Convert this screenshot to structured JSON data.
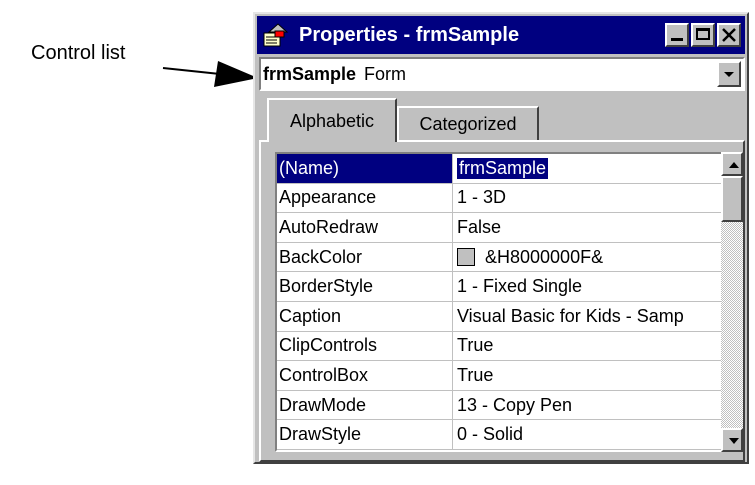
{
  "annotation": {
    "label": "Control list"
  },
  "window": {
    "title": "Properties - frmSample",
    "buttons": {
      "minimize": "minimize-icon",
      "maximize": "maximize-icon",
      "close": "close-icon"
    }
  },
  "object_combo": {
    "name": "frmSample",
    "type": "Form"
  },
  "tabs": [
    {
      "label": "Alphabetic",
      "active": true
    },
    {
      "label": "Categorized",
      "active": false
    }
  ],
  "properties": [
    {
      "name": "(Name)",
      "value": "frmSample",
      "selected": true
    },
    {
      "name": "Appearance",
      "value": "1 - 3D"
    },
    {
      "name": "AutoRedraw",
      "value": "False"
    },
    {
      "name": "BackColor",
      "value": "&H8000000F&",
      "swatch": "#c0c0c0"
    },
    {
      "name": "BorderStyle",
      "value": "1 - Fixed Single"
    },
    {
      "name": "Caption",
      "value": "Visual Basic for Kids - Samp"
    },
    {
      "name": "ClipControls",
      "value": "True"
    },
    {
      "name": "ControlBox",
      "value": "True"
    },
    {
      "name": "DrawMode",
      "value": "13 - Copy Pen"
    },
    {
      "name": "DrawStyle",
      "value": "0 - Solid"
    }
  ],
  "colors": {
    "titlebar": "#000080",
    "face": "#c0c0c0",
    "selection": "#000080"
  }
}
